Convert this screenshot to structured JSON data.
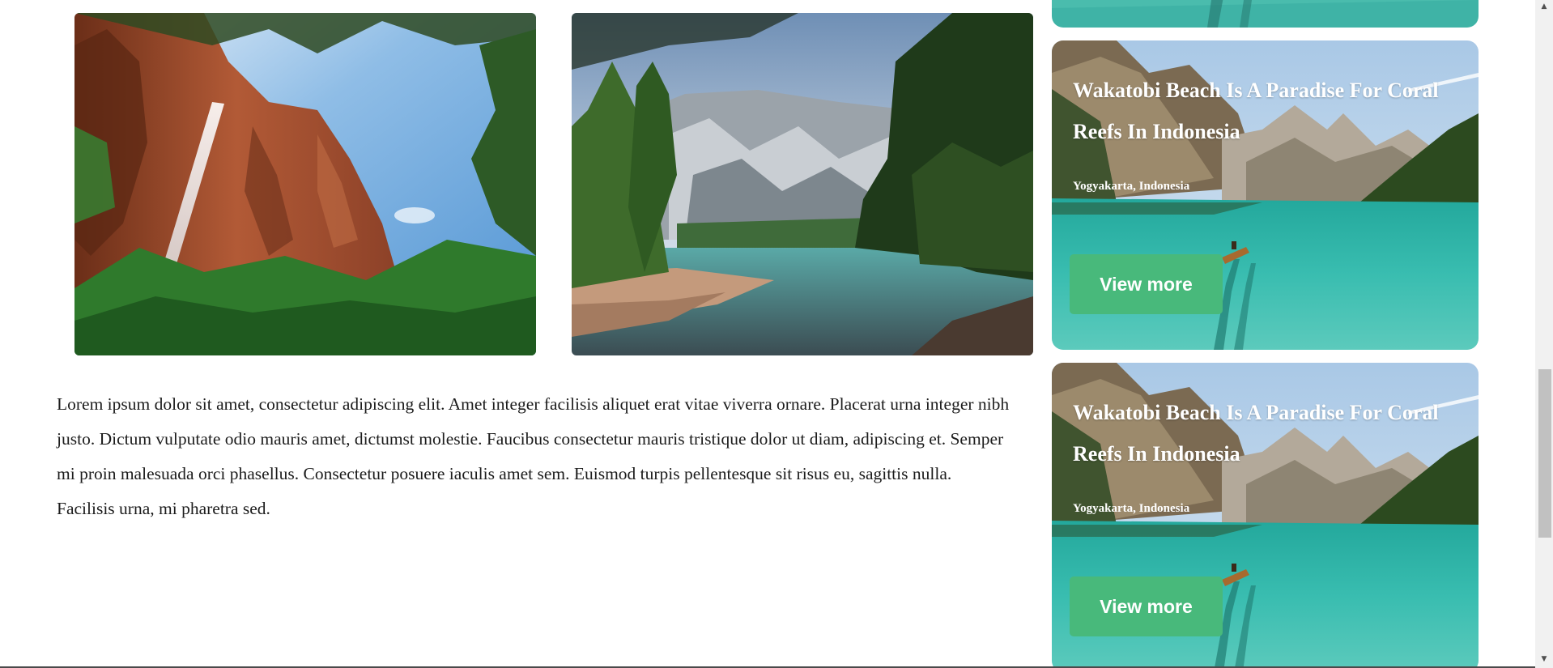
{
  "body": {
    "paragraph": "Lorem ipsum dolor sit amet, consectetur adipiscing elit. Amet integer facilisis aliquet erat vitae viverra ornare. Placerat urna integer nibh justo. Dictum vulputate odio mauris amet, dictumst molestie. Faucibus consectetur mauris tristique dolor ut diam, adipiscing et. Semper mi proin malesuada orci phasellus. Consectetur posuere iaculis amet sem. Euismod turpis pellentesque sit risus eu, sagittis nulla. Facilisis urna, mi pharetra sed."
  },
  "cards": [
    {
      "title": "Wakatobi Beach Is A Paradise For Coral Reefs In Indonesia",
      "location": "Yogyakarta, Indonesia",
      "button_label": "View more"
    },
    {
      "title": "Wakatobi Beach Is A Paradise For Coral Reefs In Indonesia",
      "location": "Yogyakarta, Indonesia",
      "button_label": "View more"
    }
  ],
  "scrollbar": {
    "up_arrow": "▲",
    "down_arrow": "▼"
  },
  "theme": {
    "button_color": "#48b97b",
    "text_color": "#1c1c1c",
    "lake_water": "#2fb7a9"
  }
}
